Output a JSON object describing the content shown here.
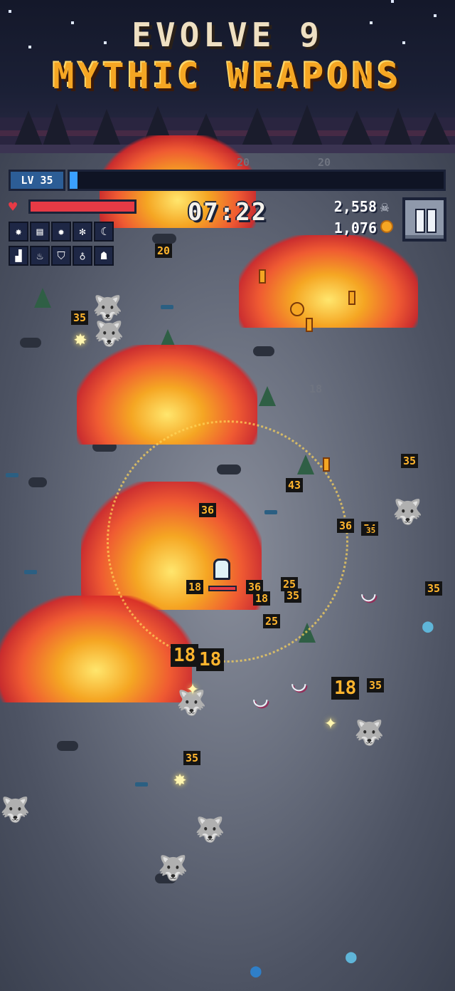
{
  "banner": {
    "line1": "EVOLVE 9",
    "line2": "MYTHIC WEAPONS"
  },
  "hud": {
    "level_label": "LV 35",
    "xp_fraction": 0.02,
    "hp_fraction": 1.0,
    "timer": "07:22",
    "kills": "2,558",
    "coins": "1,076",
    "kills_icon": "skull-icon",
    "coins_icon": "coin-icon",
    "pause_icon": "pause-icon"
  },
  "weapon_slots": [
    {
      "icon": "lightning-star-icon",
      "glyph": "✸",
      "color": "#2c5d96"
    },
    {
      "icon": "fire-scroll-icon",
      "glyph": "▤",
      "color": "#c0392b"
    },
    {
      "icon": "sun-burst-icon",
      "glyph": "✹",
      "color": "#e67e22"
    },
    {
      "icon": "snowflake-icon",
      "glyph": "✻",
      "color": "#3a4a6a"
    },
    {
      "icon": "moon-icon",
      "glyph": "☾",
      "color": "#1e2745"
    }
  ],
  "passive_slots": [
    {
      "icon": "boot-icon",
      "glyph": "▟",
      "color": "#1e2745"
    },
    {
      "icon": "pot-icon",
      "glyph": "♨",
      "color": "#1e2745"
    },
    {
      "icon": "shield-icon",
      "glyph": "⛉",
      "color": "#1e2745"
    },
    {
      "icon": "potion-icon",
      "glyph": "♁",
      "color": "#1e2745"
    },
    {
      "icon": "ghost-icon",
      "glyph": "☗",
      "color": "#1e2745"
    }
  ],
  "damage_numbers": [
    {
      "text": "20",
      "style": "normal"
    },
    {
      "text": "35",
      "style": "normal"
    },
    {
      "text": "18",
      "style": "dim"
    },
    {
      "text": "35",
      "style": "normal"
    },
    {
      "text": "43",
      "style": "normal"
    },
    {
      "text": "36",
      "style": "normal"
    },
    {
      "text": "36",
      "style": "normal"
    },
    {
      "text": "54",
      "style": "normal"
    },
    {
      "text": "35",
      "style": "normal"
    },
    {
      "text": "18",
      "style": "normal"
    },
    {
      "text": "36",
      "style": "normal"
    },
    {
      "text": "18",
      "style": "normal"
    },
    {
      "text": "25",
      "style": "normal"
    },
    {
      "text": "35",
      "style": "normal"
    },
    {
      "text": "35",
      "style": "normal"
    },
    {
      "text": "25",
      "style": "normal"
    },
    {
      "text": "18",
      "style": "big"
    },
    {
      "text": "18",
      "style": "big"
    },
    {
      "text": "18",
      "style": "big"
    },
    {
      "text": "35",
      "style": "normal"
    },
    {
      "text": "35",
      "style": "normal"
    },
    {
      "text": "20",
      "style": "dim"
    },
    {
      "text": "20",
      "style": "dim"
    }
  ]
}
